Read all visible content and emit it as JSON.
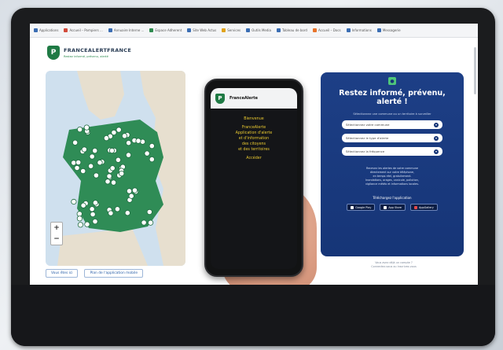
{
  "bookmarks": [
    "Applications",
    "Accueil – Pompiers ...",
    "Annuaire Interne ...",
    "Espace Adherent",
    "Site Web Actus",
    "Services",
    "Outils Media",
    "Tableau de bord",
    "Accueil – Docs",
    "Informations",
    "Messagerie"
  ],
  "brand": {
    "name": "FRANCEALERTFRANCE",
    "tagline": "Restez informé, prévenu, alerté",
    "logo_letter": "P"
  },
  "map": {
    "zoom_in": "+",
    "zoom_out": "−",
    "tabs": [
      "Vous êtes ici",
      "Plan de l'application mobile"
    ]
  },
  "phone": {
    "brand": "FranceAlerte",
    "lines": [
      "Bienvenue",
      "FranceAlerte",
      "Application d'alerte",
      "et d'information",
      "des citoyens",
      "et des territoires",
      "Accéder"
    ]
  },
  "panel": {
    "title": "Restez informé, prévenu, alerté !",
    "subtitle": "Sélectionnez une commune ou un territoire à surveiller",
    "selects": [
      "Sélectionnez votre commune",
      "Sélectionnez le type d'alerte",
      "Sélectionnez la fréquence"
    ],
    "info_lines": [
      "Recevez les alertes de votre commune",
      "directement sur votre téléphone,",
      "en temps réel, gratuitement.",
      "Inondations, orages, canicule, pollution,",
      "vigilance météo et informations locales."
    ],
    "download_label": "Téléchargez l'application",
    "stores": [
      "Google Play",
      "App Store",
      "AppGallery"
    ]
  },
  "below_panel": [
    "Vous avez déjà un compte ?",
    "Connectez-vous ou inscrivez-vous"
  ]
}
